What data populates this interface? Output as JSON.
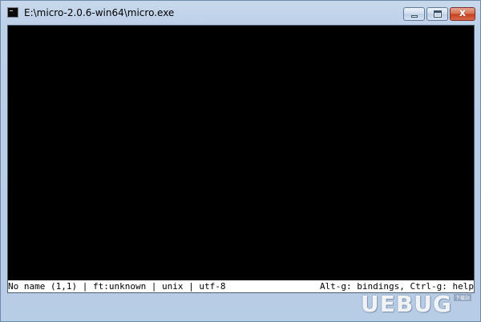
{
  "window": {
    "title": "E:\\micro-2.0.6-win64\\micro.exe",
    "close_glyph": "x",
    "icons": {
      "app": "console-app-icon",
      "minimize": "minimize-icon",
      "maximize": "maximize-icon",
      "close": "close-icon"
    }
  },
  "editor": {
    "background": "#000000",
    "status": {
      "left": "No name (1,1) | ft:unknown | unix | utf-8",
      "right": "Alt-g: bindings, Ctrl-g: help"
    }
  },
  "watermark": {
    "text": "UEBUG",
    "sub": "下载站"
  }
}
